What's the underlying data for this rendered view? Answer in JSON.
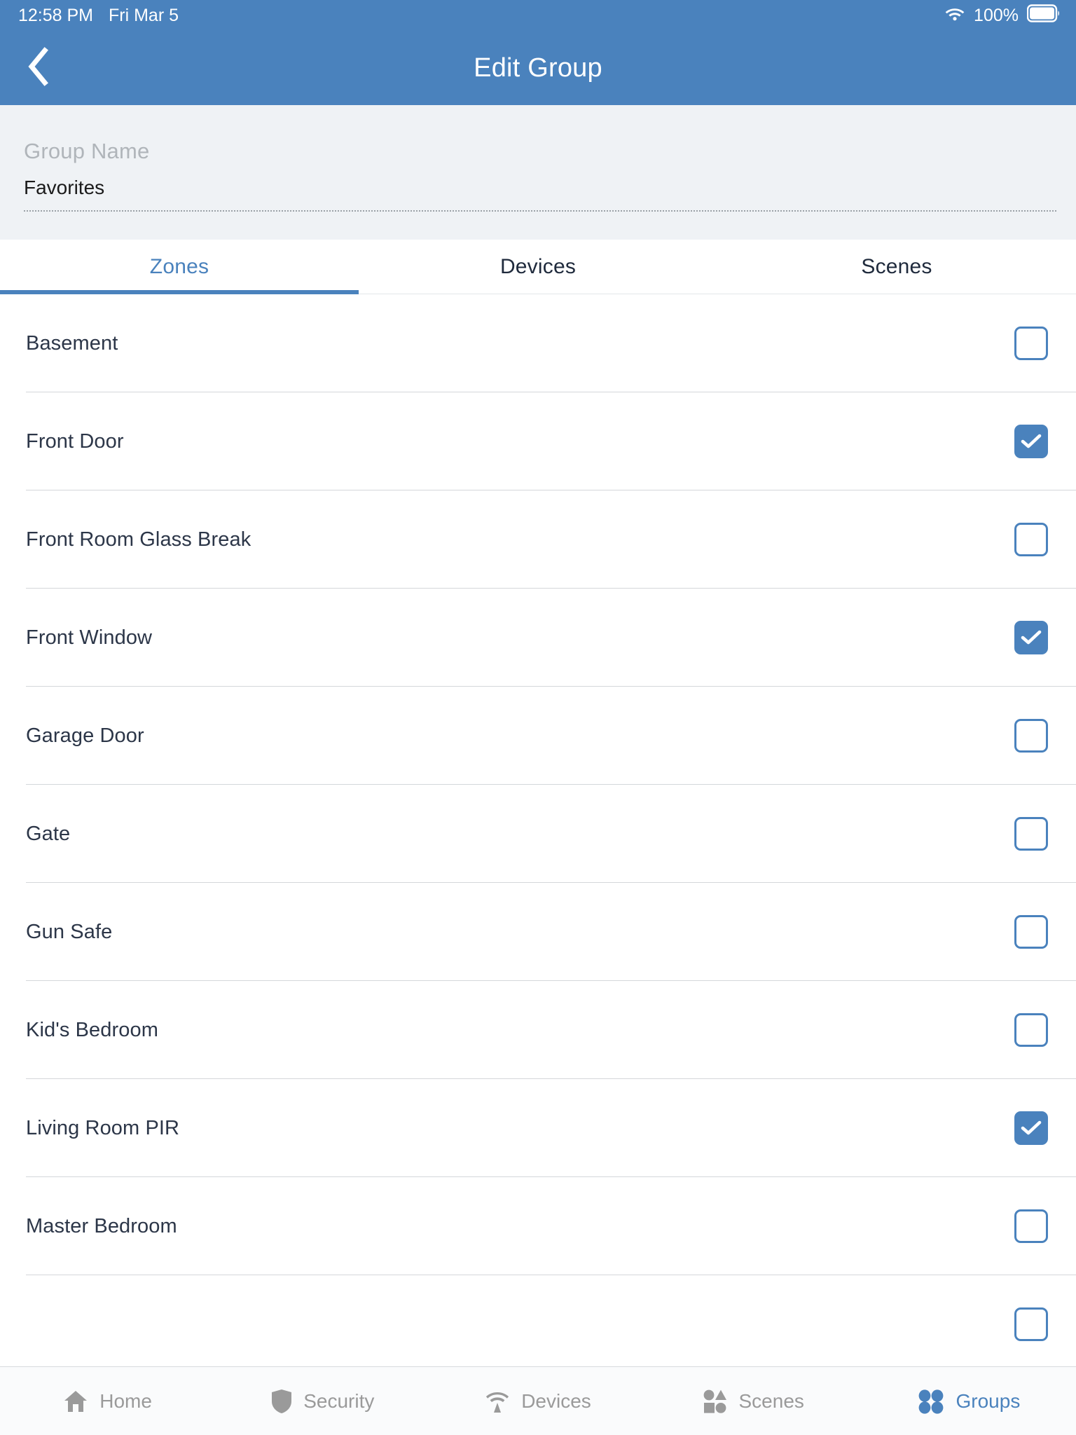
{
  "status_bar": {
    "time": "12:58 PM",
    "date": "Fri Mar 5",
    "battery_percent": "100%",
    "wifi_icon": "wifi-icon",
    "battery_icon": "battery-full-icon"
  },
  "header": {
    "title": "Edit Group",
    "back_icon": "chevron-left-icon"
  },
  "group_form": {
    "label": "Group Name",
    "value": "Favorites",
    "placeholder": "Group Name"
  },
  "tabs": [
    {
      "label": "Zones",
      "active": true
    },
    {
      "label": "Devices",
      "active": false
    },
    {
      "label": "Scenes",
      "active": false
    }
  ],
  "zones": [
    {
      "label": "Basement",
      "checked": false
    },
    {
      "label": "Front Door",
      "checked": true
    },
    {
      "label": "Front Room Glass Break",
      "checked": false
    },
    {
      "label": "Front Window",
      "checked": true
    },
    {
      "label": "Garage Door",
      "checked": false
    },
    {
      "label": "Gate",
      "checked": false
    },
    {
      "label": "Gun Safe",
      "checked": false
    },
    {
      "label": "Kid's Bedroom",
      "checked": false
    },
    {
      "label": "Living Room PIR",
      "checked": true
    },
    {
      "label": "Master Bedroom",
      "checked": false
    },
    {
      "label": "",
      "checked": false
    }
  ],
  "bottom_nav": [
    {
      "label": "Home",
      "icon": "home-icon",
      "active": false
    },
    {
      "label": "Security",
      "icon": "shield-icon",
      "active": false
    },
    {
      "label": "Devices",
      "icon": "signal-icon",
      "active": false
    },
    {
      "label": "Scenes",
      "icon": "shapes-icon",
      "active": false
    },
    {
      "label": "Groups",
      "icon": "grid-dots-icon",
      "active": true
    }
  ],
  "colors": {
    "accent": "#4a82bd",
    "header_bg": "#4a82bd",
    "panel_bg": "#eff2f5",
    "row_text": "#2c3648",
    "muted": "#9a9a9a"
  }
}
